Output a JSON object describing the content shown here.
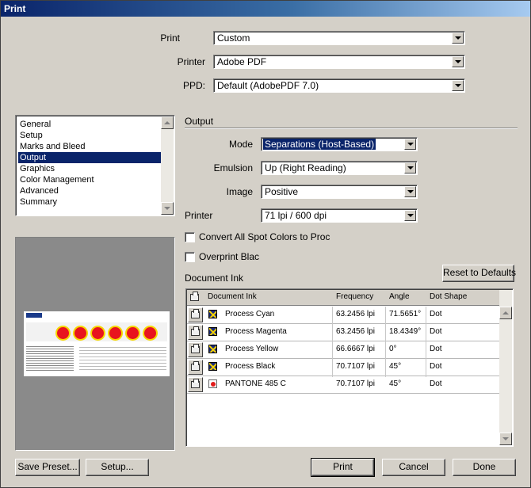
{
  "window": {
    "title": "Print"
  },
  "top_fields": {
    "print_label": "Print",
    "print_value": "Custom",
    "printer_label": "Printer",
    "printer_value": "Adobe PDF",
    "ppd_label": "PPD:",
    "ppd_value": "Default (AdobePDF 7.0)"
  },
  "categories": {
    "items": [
      "General",
      "Setup",
      "Marks and Bleed",
      "Output",
      "Graphics",
      "Color Management",
      "Advanced",
      "Summary"
    ],
    "selected": "Output"
  },
  "output": {
    "section_title": "Output",
    "mode_label": "Mode",
    "mode_value": "Separations (Host-Based)",
    "emulsion_label": "Emulsion",
    "emulsion_value": "Up (Right Reading)",
    "image_label": "Image",
    "image_value": "Positive",
    "printer_label": "Printer",
    "printer_value": "71 lpi / 600 dpi",
    "convert_spot_label": "Convert All Spot Colors to Proc",
    "convert_spot_checked": false,
    "overprint_black_label": "Overprint Blac",
    "overprint_black_checked": false
  },
  "document_ink": {
    "section_title": "Document Ink",
    "reset_button": "Reset to Defaults",
    "columns": [
      "Document Ink",
      "Frequency",
      "Angle",
      "Dot Shape"
    ],
    "rows": [
      {
        "name": "Process Cyan",
        "frequency": "63.2456 lpi",
        "angle": "71.5651°",
        "dot_shape": "Dot",
        "swatch": "process-icon"
      },
      {
        "name": "Process Magenta",
        "frequency": "63.2456 lpi",
        "angle": "18.4349°",
        "dot_shape": "Dot",
        "swatch": "process-icon"
      },
      {
        "name": "Process Yellow",
        "frequency": "66.6667 lpi",
        "angle": "0°",
        "dot_shape": "Dot",
        "swatch": "process-icon"
      },
      {
        "name": "Process Black",
        "frequency": "70.7107 lpi",
        "angle": "45°",
        "dot_shape": "Dot",
        "swatch": "process-icon"
      },
      {
        "name": "PANTONE 485 C",
        "frequency": "70.7107 lpi",
        "angle": "45°",
        "dot_shape": "Dot",
        "swatch": "spot-color-icon"
      }
    ]
  },
  "buttons": {
    "save_preset": "Save Preset...",
    "setup": "Setup...",
    "print": "Print",
    "cancel": "Cancel",
    "done": "Done"
  },
  "colors": {
    "selection": "#0a246a",
    "dialog_bg": "#d4d0c8",
    "preview_bg": "#8a8a8a",
    "spot_red": "#e21b1b"
  }
}
